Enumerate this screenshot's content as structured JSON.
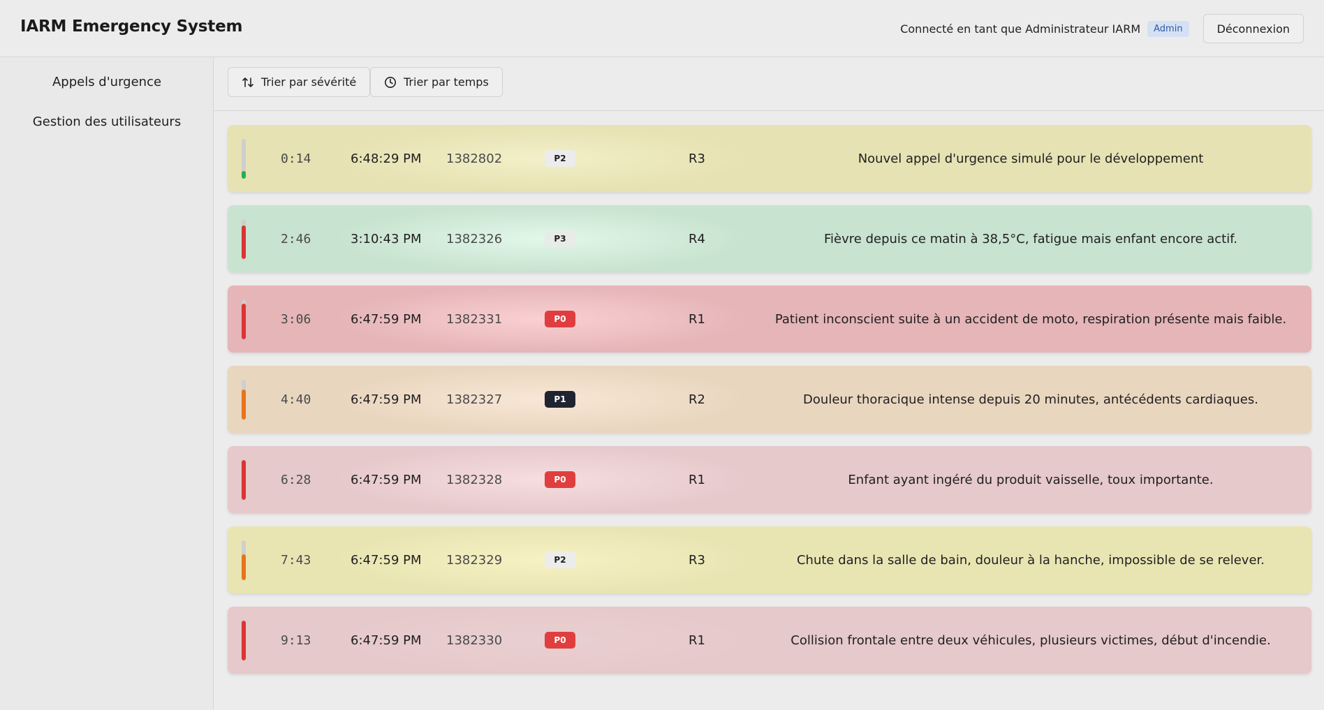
{
  "header": {
    "title": "IARM Emergency System",
    "logged_in_text": "Connecté en tant que Administrateur IARM",
    "role_badge": "Admin",
    "logout_label": "Déconnexion"
  },
  "sidebar": {
    "items": [
      {
        "label": "Appels d'urgence"
      },
      {
        "label": "Gestion des utilisateurs"
      }
    ]
  },
  "toolbar": {
    "sort_severity_label": "Trier par sévérité",
    "sort_severity_icon": "sort-arrows-icon",
    "sort_time_label": "Trier par temps",
    "sort_time_icon": "clock-icon"
  },
  "priority_styles": {
    "P0": {
      "bg": "#e03e3e",
      "fg": "#ffffff"
    },
    "P1": {
      "bg": "#1f2430",
      "fg": "#ffffff"
    },
    "P2": {
      "bg": "#ececec",
      "fg": "#1f1f1f"
    },
    "P3": {
      "bg": "#e8ece8",
      "fg": "#1f1f1f"
    }
  },
  "calls": [
    {
      "elapsed": "0:14",
      "time": "6:48:29 PM",
      "id": "1382802",
      "priority": "P2",
      "response": "R3",
      "description": "Nouvel appel d'urgence simulé pour le développement",
      "row_color": "#e6e2b3",
      "glow_color": "#f3efc8",
      "bar_color": "#22b14c",
      "bar_level": 0.2
    },
    {
      "elapsed": "2:46",
      "time": "3:10:43 PM",
      "id": "1382326",
      "priority": "P3",
      "response": "R4",
      "description": "Fièvre depuis ce matin à 38,5°C, fatigue mais enfant encore actif.",
      "row_color": "#c8e3d0",
      "glow_color": "#e2f7e8",
      "bar_color": "#dc3333",
      "bar_level": 0.85
    },
    {
      "elapsed": "3:06",
      "time": "6:47:59 PM",
      "id": "1382331",
      "priority": "P0",
      "response": "R1",
      "description": "Patient inconscient suite à un accident de moto, respiration présente mais faible.",
      "row_color": "#e5b5b8",
      "glow_color": "#fad0d2",
      "bar_color": "#dc3333",
      "bar_level": 0.9
    },
    {
      "elapsed": "4:40",
      "time": "6:47:59 PM",
      "id": "1382327",
      "priority": "P1",
      "response": "R2",
      "description": "Douleur thoracique intense depuis 20 minutes, antécédents cardiaques.",
      "row_color": "#e9d6bf",
      "glow_color": "#f8e7d6",
      "bar_color": "#e8731a",
      "bar_level": 0.75
    },
    {
      "elapsed": "6:28",
      "time": "6:47:59 PM",
      "id": "1382328",
      "priority": "P0",
      "response": "R1",
      "description": "Enfant ayant ingéré du produit vaisselle, toux importante.",
      "row_color": "#e6c9cb",
      "glow_color": "#f6dde0",
      "bar_color": "#dc3333",
      "bar_level": 1.0
    },
    {
      "elapsed": "7:43",
      "time": "6:47:59 PM",
      "id": "1382329",
      "priority": "P2",
      "response": "R3",
      "description": "Chute dans la salle de bain, douleur à la hanche, impossible de se relever.",
      "row_color": "#e9e5b3",
      "glow_color": "#f7f1c3",
      "bar_color": "#e8731a",
      "bar_level": 0.65
    },
    {
      "elapsed": "9:13",
      "time": "6:47:59 PM",
      "id": "1382330",
      "priority": "P0",
      "response": "R1",
      "description": "Collision frontale entre deux véhicules, plusieurs victimes, début d'incendie.",
      "row_color": "#e6c9cb",
      "glow_color": "#e9cfd1",
      "bar_color": "#dc3333",
      "bar_level": 1.0
    }
  ]
}
